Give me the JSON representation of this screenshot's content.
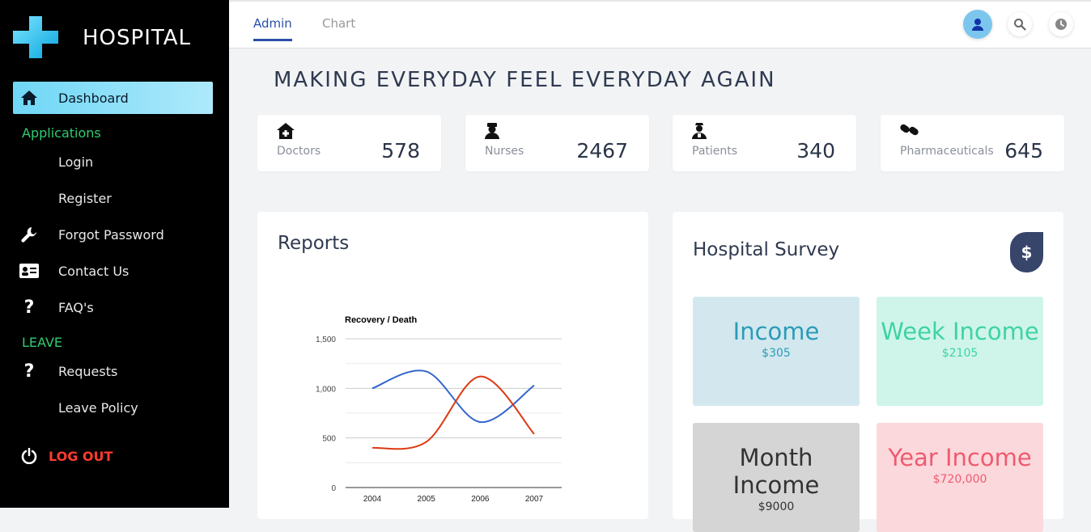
{
  "brand": {
    "name": "HOSPITAL"
  },
  "sidebar": {
    "active": "Dashboard",
    "sections": {
      "applications": "Applications",
      "leave": "LEAVE"
    },
    "items": [
      {
        "label": "Dashboard",
        "icon": "home-icon"
      },
      {
        "label": "Login",
        "icon": ""
      },
      {
        "label": "Register",
        "icon": ""
      },
      {
        "label": "Forgot Password",
        "icon": "wrench-icon"
      },
      {
        "label": "Contact Us",
        "icon": "id-card-icon"
      },
      {
        "label": "FAQ's",
        "icon": "question-icon"
      },
      {
        "label": "Requests",
        "icon": "question-icon"
      },
      {
        "label": "Leave Policy",
        "icon": ""
      }
    ],
    "logout": "LOG OUT"
  },
  "topbar": {
    "tabs": [
      "Admin",
      "Chart"
    ],
    "active_tab": "Admin",
    "icons": [
      "user-icon",
      "search-icon",
      "clock-icon"
    ]
  },
  "headline": "MAKING EVERYDAY FEEL EVERYDAY AGAIN",
  "stats": [
    {
      "label": "Doctors",
      "value": "578",
      "icon": "hospital-icon"
    },
    {
      "label": "Nurses",
      "value": "2467",
      "icon": "nurse-icon"
    },
    {
      "label": "Patients",
      "value": "340",
      "icon": "patient-icon"
    },
    {
      "label": "Pharmaceuticals",
      "value": "645",
      "icon": "pills-icon"
    }
  ],
  "reports": {
    "title": "Reports",
    "chart_data": {
      "type": "line",
      "title": "Recovery / Death",
      "x": [
        "2004",
        "2005",
        "2006",
        "2007"
      ],
      "ylim": [
        0,
        1500
      ],
      "yticks": [
        "0",
        "500",
        "1,000",
        "1,500"
      ],
      "grid": true,
      "series": [
        {
          "values": [
            1000,
            1170,
            660,
            1030
          ],
          "color": "#3366cc"
        },
        {
          "values": [
            400,
            460,
            1120,
            540
          ],
          "color": "#dc3912"
        }
      ]
    }
  },
  "survey": {
    "title": "Hospital Survey",
    "badge": "$",
    "tiles": [
      {
        "title": "Income",
        "value": "$305"
      },
      {
        "title": "Week Income",
        "value": "$2105"
      },
      {
        "title": "Month Income",
        "value": "$9000"
      },
      {
        "title": "Year Income",
        "value": "$720,000"
      }
    ]
  }
}
